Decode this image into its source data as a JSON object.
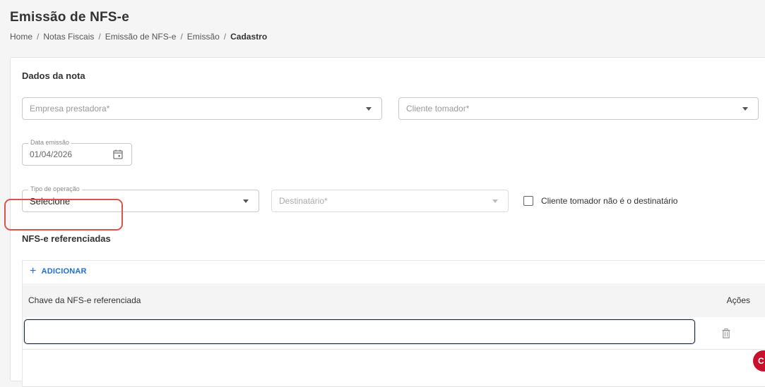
{
  "page": {
    "title": "Emissão de NFS-e",
    "breadcrumb": [
      "Home",
      "Notas Fiscais",
      "Emissão de NFS-e",
      "Emissão",
      "Cadastro"
    ],
    "breadcrumb_separator": "/"
  },
  "dados_nota": {
    "section_title": "Dados da nota",
    "empresa_prestadora": {
      "placeholder": "Empresa prestadora*",
      "value": ""
    },
    "cliente_tomador": {
      "placeholder": "Cliente tomador*",
      "value": ""
    },
    "data_emissao": {
      "label": "Data emissão",
      "value": "01/04/2026",
      "icon": "calendar-icon"
    },
    "tipo_operacao": {
      "label": "Tipo de operação",
      "value": "Selecione"
    },
    "destinatario": {
      "placeholder": "Destinatário*",
      "value": "",
      "disabled": true
    },
    "checkbox_tomador": {
      "label": "Cliente tomador não é o destinatário",
      "checked": false
    }
  },
  "nfse_referenciadas": {
    "section_title": "NFS-e referenciadas",
    "add_button": {
      "icon": "plus-icon",
      "label": "ADICIONAR"
    },
    "columns": [
      "Chave da NFS-e referenciada",
      "Ações"
    ],
    "rows": [
      {
        "chave": "",
        "action_icon": "trash-icon"
      }
    ]
  },
  "colors": {
    "accent": "#1e6fd9",
    "highlight": "#d9534f",
    "chat_badge": "#c8102e"
  }
}
